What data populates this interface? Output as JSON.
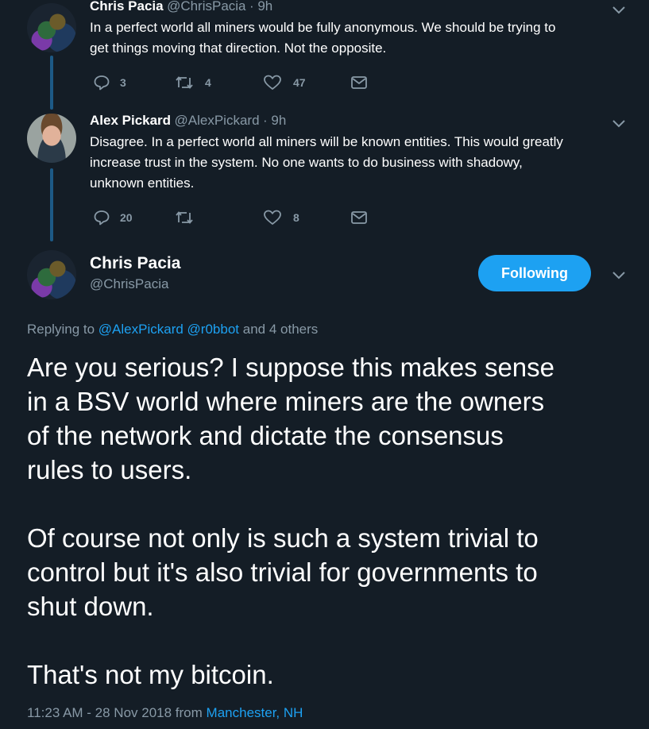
{
  "tweet1": {
    "name": "Chris Pacia",
    "handle": "@ChrisPacia",
    "time": "· 9h",
    "text_line1": "In a perfect world all miners would be fully anonymous. We should be trying to",
    "text_line2": "get things moving that direction. Not the opposite.",
    "replies": "3",
    "retweets": "4",
    "likes": "47"
  },
  "tweet2": {
    "name": "Alex Pickard",
    "handle": "@AlexPickard",
    "time": "· 9h",
    "text_line1": "Disagree. In a perfect world all miners will be known entities. This would greatly",
    "text_line2": "increase trust in the system. No one wants to do business with shadowy,",
    "text_line3": "unknown entities.",
    "replies": "20",
    "retweets": "",
    "likes": "8"
  },
  "main": {
    "name": "Chris Pacia",
    "handle": "@ChrisPacia",
    "follow_label": "Following",
    "replying_prefix": "Replying to",
    "replying_user1": "@AlexPickard",
    "replying_user2": "@r0bbot",
    "replying_suffix": "and 4 others",
    "para1_line1": "Are you serious? I suppose this makes sense",
    "para1_line2": "in a BSV world where miners are the owners",
    "para1_line3": "of the network and dictate the consensus",
    "para1_line4": "rules to users.",
    "para2_line1": "Of course not only is such a system trivial to",
    "para2_line2": "control but it's also trivial for governments to",
    "para2_line3": "shut down.",
    "para3_line1": "That's not my bitcoin.",
    "timestamp": "11:23 AM - 28 Nov 2018 from",
    "location": "Manchester, NH"
  },
  "colors": {
    "background": "#141d26",
    "accent": "#1da1f2",
    "muted": "#8899a6",
    "thread_line": "#1d5a86"
  },
  "icons": [
    "reply-icon",
    "retweet-icon",
    "like-icon",
    "message-icon",
    "chevron-down-icon"
  ]
}
